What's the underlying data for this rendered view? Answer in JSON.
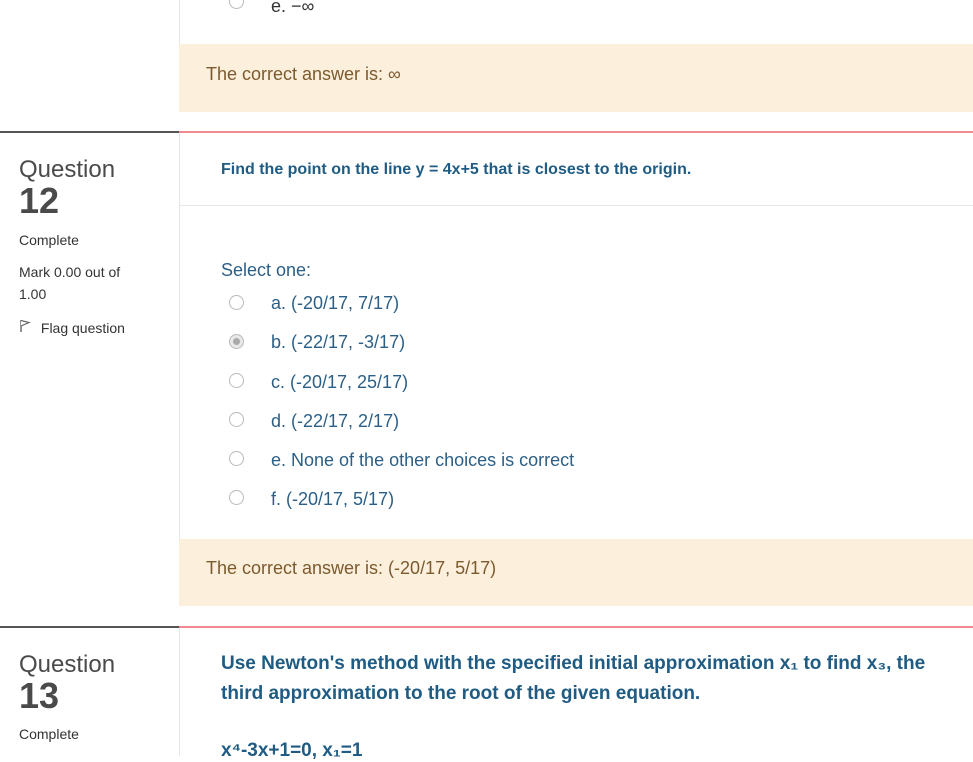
{
  "prev": {
    "last_option": "e. −∞",
    "feedback": "The correct answer is: ∞"
  },
  "q12": {
    "label": "Question",
    "number": "12",
    "state": "Complete",
    "mark_line1": "Mark 0.00 out of",
    "mark_line2": "1.00",
    "flag": "Flag question",
    "text": "Find the point on the line y = 4x+5 that is closest to the origin.",
    "prompt": "Select one:",
    "options": [
      {
        "label": "a. (-20/17, 7/17)",
        "checked": false
      },
      {
        "label": "b. (-22/17, -3/17)",
        "checked": true
      },
      {
        "label": "c. (-20/17, 25/17)",
        "checked": false
      },
      {
        "label": "d. (-22/17, 2/17)",
        "checked": false
      },
      {
        "label": "e. None of the other choices is correct",
        "checked": false
      },
      {
        "label": "f. (-20/17, 5/17)",
        "checked": false
      }
    ],
    "feedback": "The correct answer is: (-20/17, 5/17)"
  },
  "q13": {
    "label": "Question",
    "number": "13",
    "state": "Complete",
    "text_line1": "Use Newton's method with the specified initial approximation x₁ to find x₃, the",
    "text_line2": "third approximation to the root of the given equation.",
    "equation": "x⁴-3x+1=0, x₁=1"
  },
  "colors": {
    "accent_divider": "#f08a8f",
    "feedback_bg": "#fcefdc",
    "question_text": "#1f5b82"
  }
}
